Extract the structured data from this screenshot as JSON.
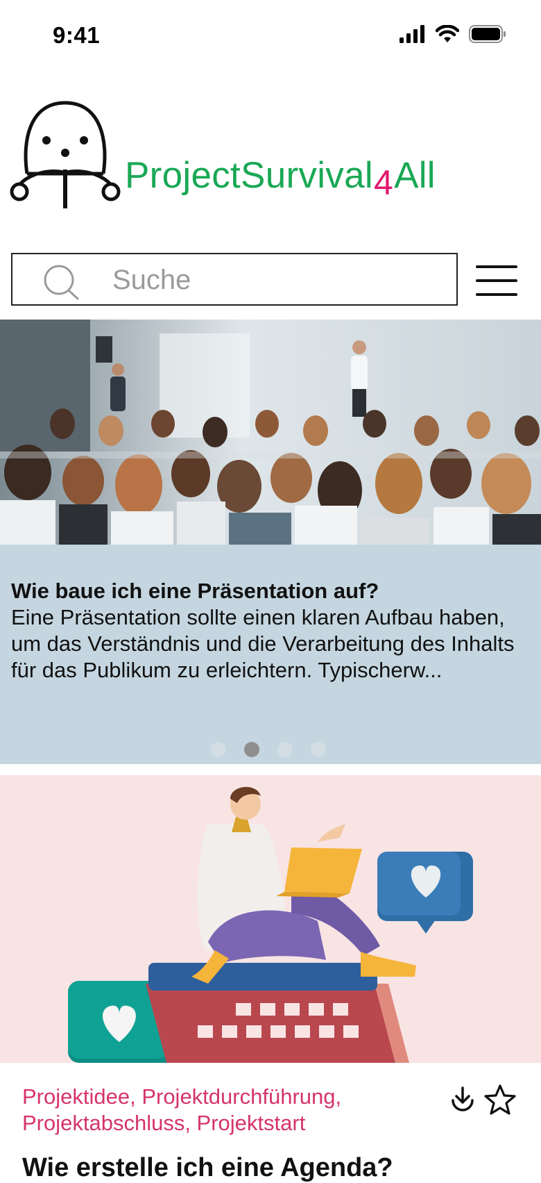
{
  "status_bar": {
    "time": "9:41"
  },
  "brand": {
    "name_part1": "ProjectSurvival",
    "name_digit": "4",
    "name_part2": "All",
    "color_primary": "#19a855",
    "color_accent": "#e0186e"
  },
  "search": {
    "placeholder": "Suche",
    "value": ""
  },
  "menu": {
    "icon": "hamburger-menu-icon"
  },
  "carousel": {
    "title": "Wie baue ich eine Präsentation auf?",
    "excerpt": "Eine Präsentation sollte einen klaren Aufbau haben, um das Verständnis und die Verarbeitung des Inhalts für das Publikum zu erleichtern. Typischerw...",
    "slide_count": 4,
    "active_index": 1,
    "background_color": "#c5d6e0"
  },
  "card": {
    "tags": "Projektidee, Projektdurchführung, Projektabschluss, Projektstart",
    "title": "Wie erstelle ich eine Agenda?",
    "tag_color": "#d6336c",
    "image_background": "#f9e4e4"
  }
}
